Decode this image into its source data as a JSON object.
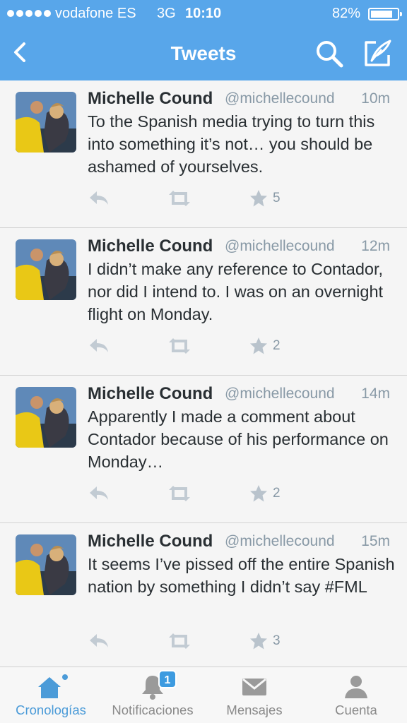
{
  "status_bar": {
    "carrier": "vodafone ES",
    "network": "3G",
    "time": "10:10",
    "battery_percent": "82%",
    "battery_level": 0.82
  },
  "nav": {
    "title": "Tweets",
    "back_icon": "chevron-left-icon",
    "search_icon": "search-icon",
    "compose_icon": "compose-icon"
  },
  "tweets": [
    {
      "name": "Michelle Cound",
      "handle": "@michellecound",
      "time": "10m",
      "text": "To the Spanish media trying to turn this into something it’s not… you should be ashamed of yourselves.",
      "favorites": "5"
    },
    {
      "name": "Michelle Cound",
      "handle": "@michellecound",
      "time": "12m",
      "text": "I didn’t make any reference to Contador, nor did I intend to. I was on an overnight flight on Monday.",
      "favorites": "2"
    },
    {
      "name": "Michelle Cound",
      "handle": "@michellecound",
      "time": "14m",
      "text": "Apparently I made a comment about Contador because of his performance on Monday…",
      "favorites": "2"
    },
    {
      "name": "Michelle Cound",
      "handle": "@michellecound",
      "time": "15m",
      "text": "It seems I’ve pissed off the entire Spanish nation by something I didn’t say #FML",
      "favorites": "3"
    }
  ],
  "tabbar": {
    "tabs": [
      {
        "label": "Cronologías",
        "icon": "home-icon",
        "active": true
      },
      {
        "label": "Notificaciones",
        "icon": "bell-icon",
        "badge": "1"
      },
      {
        "label": "Mensajes",
        "icon": "envelope-icon"
      },
      {
        "label": "Cuenta",
        "icon": "person-icon"
      }
    ]
  },
  "colors": {
    "header_bg": "#58a6ea",
    "accent": "#4b9bd8",
    "text": "#292f33",
    "muted": "#8899a6"
  }
}
